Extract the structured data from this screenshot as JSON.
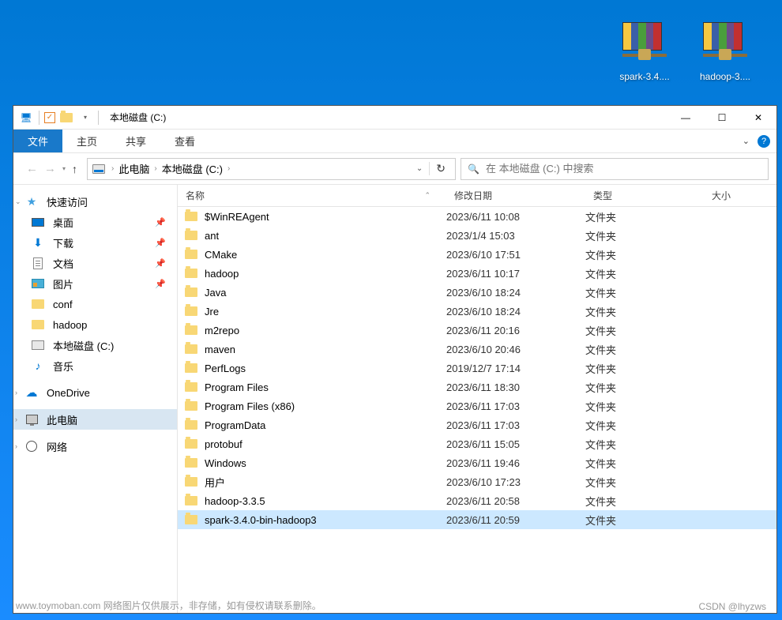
{
  "desktop": {
    "icons": [
      {
        "label": "spark-3.4...."
      },
      {
        "label": "hadoop-3...."
      }
    ]
  },
  "window": {
    "title": "本地磁盘 (C:)",
    "controls": {
      "min": "—",
      "max": "☐",
      "close": "✕"
    }
  },
  "ribbon": {
    "file": "文件",
    "home": "主页",
    "share": "共享",
    "view": "查看"
  },
  "breadcrumb": {
    "root": "此电脑",
    "current": "本地磁盘 (C:)"
  },
  "search": {
    "placeholder": "在 本地磁盘 (C:) 中搜索"
  },
  "sidebar": {
    "quickAccess": "快速访问",
    "desktop": "桌面",
    "downloads": "下载",
    "documents": "文档",
    "pictures": "图片",
    "conf": "conf",
    "hadoop": "hadoop",
    "localDisk": "本地磁盘 (C:)",
    "music": "音乐",
    "onedrive": "OneDrive",
    "thisPC": "此电脑",
    "network": "网络"
  },
  "columns": {
    "name": "名称",
    "date": "修改日期",
    "type": "类型",
    "size": "大小"
  },
  "folderType": "文件夹",
  "files": [
    {
      "name": "$WinREAgent",
      "date": "2023/6/11 10:08",
      "type": "文件夹"
    },
    {
      "name": "ant",
      "date": "2023/1/4 15:03",
      "type": "文件夹"
    },
    {
      "name": "CMake",
      "date": "2023/6/10 17:51",
      "type": "文件夹"
    },
    {
      "name": "hadoop",
      "date": "2023/6/11 10:17",
      "type": "文件夹"
    },
    {
      "name": "Java",
      "date": "2023/6/10 18:24",
      "type": "文件夹"
    },
    {
      "name": "Jre",
      "date": "2023/6/10 18:24",
      "type": "文件夹"
    },
    {
      "name": "m2repo",
      "date": "2023/6/11 20:16",
      "type": "文件夹"
    },
    {
      "name": "maven",
      "date": "2023/6/10 20:46",
      "type": "文件夹"
    },
    {
      "name": "PerfLogs",
      "date": "2019/12/7 17:14",
      "type": "文件夹"
    },
    {
      "name": "Program Files",
      "date": "2023/6/11 18:30",
      "type": "文件夹"
    },
    {
      "name": "Program Files (x86)",
      "date": "2023/6/11 17:03",
      "type": "文件夹"
    },
    {
      "name": "ProgramData",
      "date": "2023/6/11 17:03",
      "type": "文件夹"
    },
    {
      "name": "protobuf",
      "date": "2023/6/11 15:05",
      "type": "文件夹"
    },
    {
      "name": "Windows",
      "date": "2023/6/11 19:46",
      "type": "文件夹"
    },
    {
      "name": "用户",
      "date": "2023/6/10 17:23",
      "type": "文件夹"
    },
    {
      "name": "hadoop-3.3.5",
      "date": "2023/6/11 20:58",
      "type": "文件夹"
    },
    {
      "name": "spark-3.4.0-bin-hadoop3",
      "date": "2023/6/11 20:59",
      "type": "文件夹",
      "selected": true
    }
  ],
  "watermark": {
    "left": "www.toymoban.com 网络图片仅供展示，非存储，如有侵权请联系删除。",
    "right": "CSDN @lhyzws"
  }
}
